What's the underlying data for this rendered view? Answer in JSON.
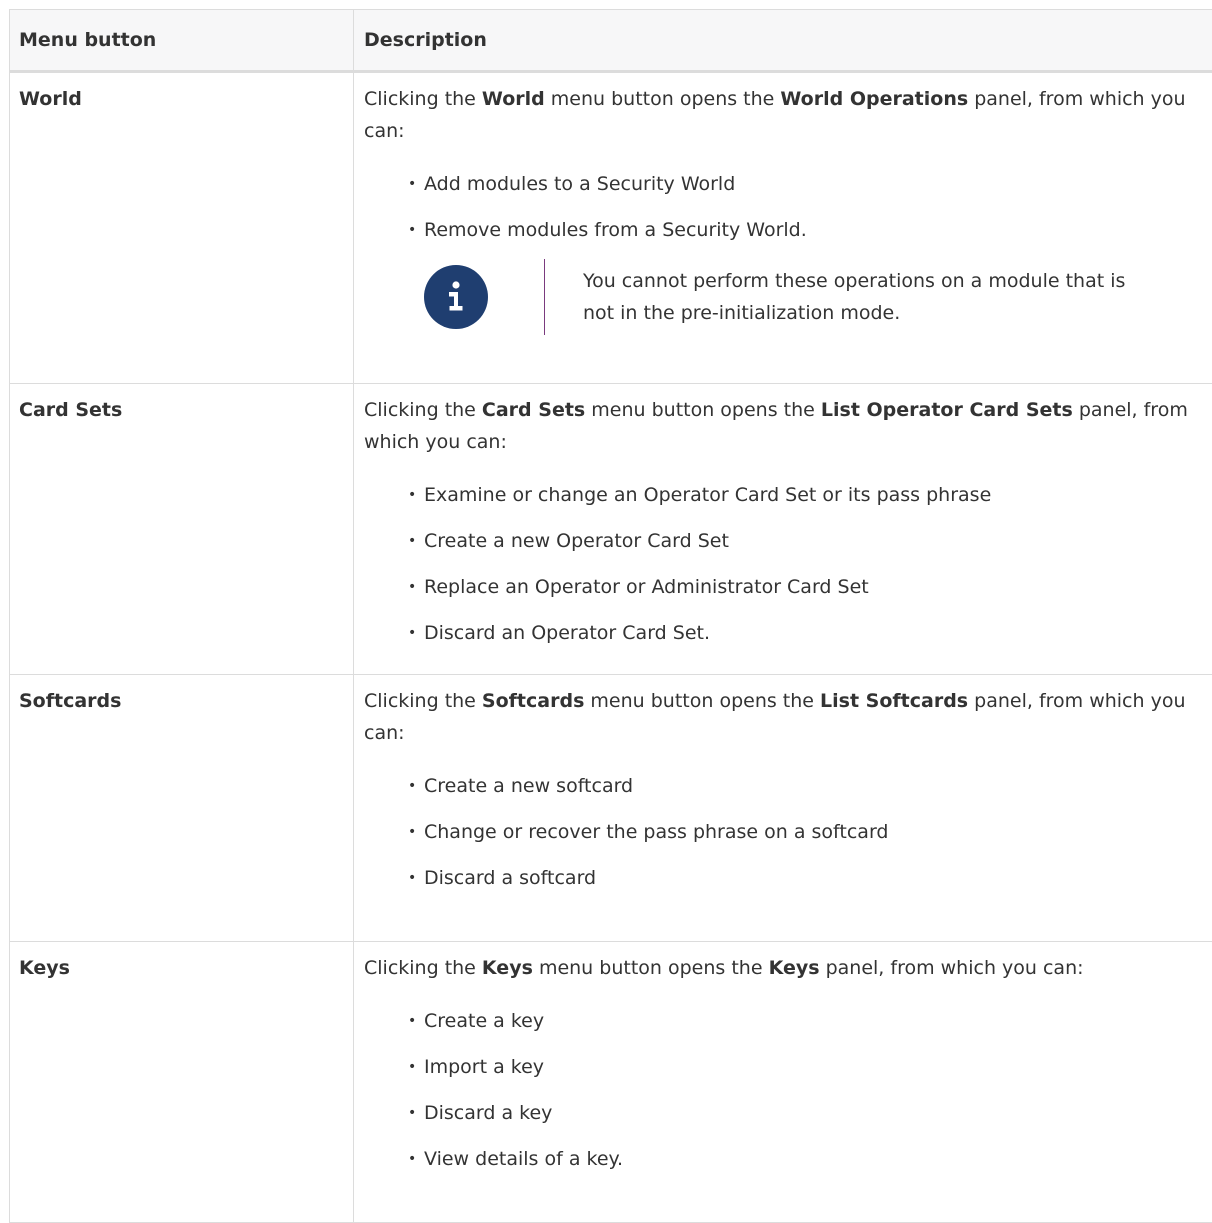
{
  "table": {
    "headers": [
      "Menu button",
      "Description"
    ],
    "rows": [
      {
        "button": "World",
        "intro": [
          {
            "t": "Clicking the "
          },
          {
            "t": "World",
            "b": true
          },
          {
            "t": " menu button opens the "
          },
          {
            "t": "World Operations",
            "b": true
          },
          {
            "t": " panel, from which you can:"
          }
        ],
        "items": [
          "Add modules to a Security World",
          "Remove modules from a Security World."
        ],
        "note": "You cannot perform these operations on a module that is not in the pre-initialization mode.",
        "note_icon": "info-icon"
      },
      {
        "button": "Card Sets",
        "intro": [
          {
            "t": "Clicking the "
          },
          {
            "t": "Card Sets",
            "b": true
          },
          {
            "t": " menu button opens the "
          },
          {
            "t": "List Operator Card Sets",
            "b": true
          },
          {
            "t": " panel, from which you can:"
          }
        ],
        "items": [
          "Examine or change an Operator Card Set or its pass phrase",
          "Create a new Operator Card Set",
          "Replace an Operator or Administrator Card Set",
          "Discard an Operator Card Set."
        ]
      },
      {
        "button": "Softcards",
        "intro": [
          {
            "t": "Clicking the "
          },
          {
            "t": "Softcards",
            "b": true
          },
          {
            "t": " menu button opens the "
          },
          {
            "t": "List Softcards",
            "b": true
          },
          {
            "t": " panel, from which you can:"
          }
        ],
        "items": [
          "Create a new softcard",
          "Change or recover the pass phrase on a softcard",
          "Discard a softcard"
        ]
      },
      {
        "button": "Keys",
        "intro": [
          {
            "t": "Clicking the "
          },
          {
            "t": "Keys",
            "b": true
          },
          {
            "t": " menu button opens the "
          },
          {
            "t": "Keys",
            "b": true
          },
          {
            "t": " panel, from which you can:"
          }
        ],
        "items": [
          "Create a key",
          "Import a key",
          "Discard a key",
          "View details of a key."
        ]
      }
    ]
  },
  "colors": {
    "info_icon_bg": "#1f3e70",
    "note_divider": "#7a3a7e",
    "header_bg": "#f7f7f8"
  }
}
